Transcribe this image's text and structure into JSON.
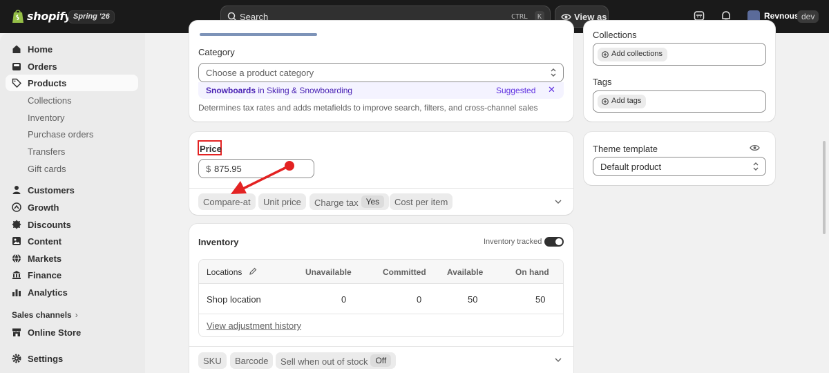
{
  "topbar": {
    "brand": "shopify",
    "edition": "Spring '26",
    "search_placeholder": "Search",
    "shortcut_ctrl": "CTRL",
    "shortcut_k": "K",
    "view_as": "View as",
    "user_name": "Revnous",
    "user_badge": "dev"
  },
  "sidebar": {
    "items": [
      {
        "label": "Home",
        "icon": "home-icon"
      },
      {
        "label": "Orders",
        "icon": "orders-icon"
      },
      {
        "label": "Products",
        "icon": "tag-icon",
        "active": true
      },
      {
        "label": "Collections",
        "sub": true
      },
      {
        "label": "Inventory",
        "sub": true
      },
      {
        "label": "Purchase orders",
        "sub": true
      },
      {
        "label": "Transfers",
        "sub": true
      },
      {
        "label": "Gift cards",
        "sub": true
      },
      {
        "label": "Customers",
        "icon": "person-icon"
      },
      {
        "label": "Growth",
        "icon": "growth-icon"
      },
      {
        "label": "Discounts",
        "icon": "discount-icon"
      },
      {
        "label": "Content",
        "icon": "content-icon"
      },
      {
        "label": "Markets",
        "icon": "globe-icon"
      },
      {
        "label": "Finance",
        "icon": "bank-icon"
      },
      {
        "label": "Analytics",
        "icon": "analytics-icon"
      }
    ],
    "channels_label": "Sales channels",
    "online_store": "Online Store",
    "settings": "Settings"
  },
  "category_card": {
    "label": "Category",
    "placeholder": "Choose a product category",
    "suggestion_bold": "Snowboards",
    "suggestion_rest": " in Skiing & Snowboarding",
    "suggested_tag": "Suggested",
    "dismiss": "✕",
    "help": "Determines tax rates and adds metafields to improve search, filters, and cross-channel sales"
  },
  "price_card": {
    "label": "Price",
    "currency": "$",
    "amount": "875.95",
    "pills": {
      "compare_at": "Compare-at",
      "unit_price": "Unit price",
      "charge_tax": "Charge tax",
      "charge_tax_value": "Yes",
      "cost_per_item": "Cost per item"
    }
  },
  "inventory_card": {
    "title": "Inventory",
    "tracked_label": "Inventory tracked",
    "tracked_on": true,
    "columns": [
      "Locations",
      "Unavailable",
      "Committed",
      "Available",
      "On hand"
    ],
    "rows": [
      {
        "location": "Shop location",
        "unavailable": "0",
        "committed": "0",
        "available": "50",
        "on_hand": "50"
      }
    ],
    "adjustment_link": "View adjustment history",
    "pills": {
      "sku": "SKU",
      "barcode": "Barcode",
      "sell_oos": "Sell when out of stock",
      "sell_oos_value": "Off"
    }
  },
  "organization_card": {
    "collections_label": "Collections",
    "add_collections": "Add collections",
    "tags_label": "Tags",
    "add_tags": "Add tags"
  },
  "theme_card": {
    "label": "Theme template",
    "value": "Default product"
  },
  "colors": {
    "annotation_red": "#e32222",
    "suggest_purple": "#4a23b4",
    "topbar": "#1a1a1a"
  }
}
